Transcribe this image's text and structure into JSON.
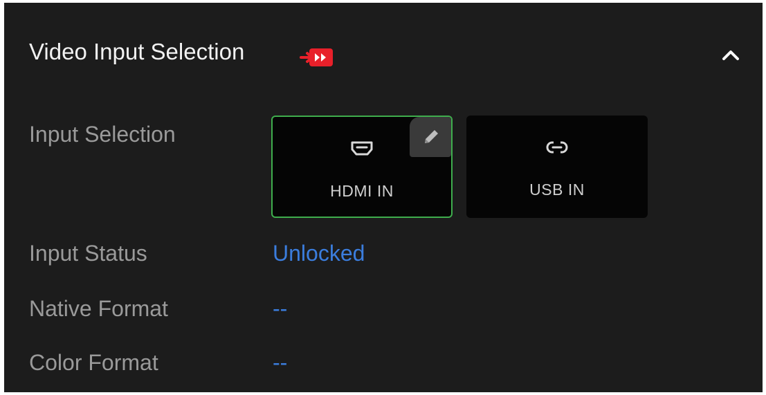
{
  "panel": {
    "title": "Video Input Selection",
    "badge_icon": "video-input-badge-icon",
    "collapse_icon": "chevron-up-icon"
  },
  "input_selection": {
    "label": "Input Selection",
    "options": [
      {
        "label": "HDMI IN",
        "icon": "hdmi-icon",
        "selected": true
      },
      {
        "label": "USB IN",
        "icon": "link-icon",
        "selected": false
      }
    ],
    "edit_icon": "pencil-icon"
  },
  "input_status": {
    "label": "Input Status",
    "value": "Unlocked"
  },
  "native_format": {
    "label": "Native Format",
    "value": "--"
  },
  "color_format": {
    "label": "Color Format",
    "value": "--"
  },
  "colors": {
    "panel_bg": "#1c1c1c",
    "tile_bg": "#050505",
    "selected_border": "#3fae4d",
    "value_text": "#3b7ddd",
    "badge_red": "#e8202a"
  }
}
